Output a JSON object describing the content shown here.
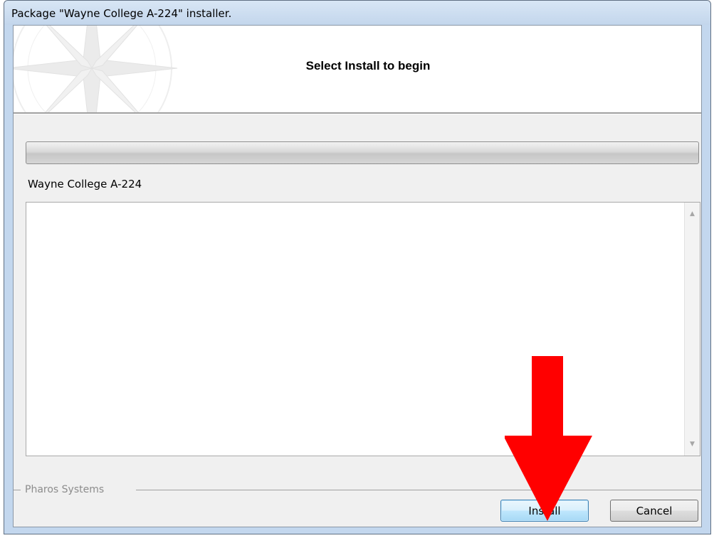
{
  "window": {
    "title": "Package \"Wayne College A-224\" installer."
  },
  "banner": {
    "title": "Select Install to begin"
  },
  "progress": {
    "value_percent": 0
  },
  "package": {
    "name": "Wayne College A-224"
  },
  "log": {
    "text": ""
  },
  "footer": {
    "group_label": "Pharos Systems",
    "install_label": "Install",
    "cancel_label": "Cancel"
  },
  "colors": {
    "annotation_arrow": "#ff0000",
    "default_button_border": "#3c7fb1",
    "window_frame": "#c3d7ee"
  },
  "icons": {
    "banner_graphic": "compass-rose-icon",
    "scroll_up": "scroll-up-arrow-icon",
    "scroll_down": "scroll-down-arrow-icon",
    "annotation": "red-down-arrow-icon"
  }
}
